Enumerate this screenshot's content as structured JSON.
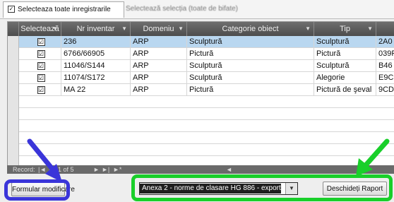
{
  "tabs": [
    {
      "label": "Selecteaza toate inregistrarile",
      "checked": true
    },
    {
      "label": "Selectează selecția (toate de bifate)"
    }
  ],
  "grid": {
    "columns": [
      "Selectează",
      "Nr inventar",
      "Domeniu",
      "Categorie obiect",
      "Tip"
    ],
    "rows": [
      {
        "selected": true,
        "nr": "236",
        "domeniu": "ARP",
        "categorie": "Sculptură",
        "tip": "Sculptură",
        "extra": "2A0"
      },
      {
        "selected": false,
        "nr": "6766/66905",
        "domeniu": "ARP",
        "categorie": "Pictură",
        "tip": "Pictură",
        "extra": "039F"
      },
      {
        "selected": false,
        "nr": "11046/S144",
        "domeniu": "ARP",
        "categorie": "Sculptură",
        "tip": "Sculptură",
        "extra": "B46"
      },
      {
        "selected": false,
        "nr": "11074/S172",
        "domeniu": "ARP",
        "categorie": "Sculptură",
        "tip": "Alegorie",
        "extra": "E9C"
      },
      {
        "selected": false,
        "nr": "MA 22",
        "domeniu": "ARP",
        "categorie": "Pictură",
        "tip": "Pictură de şeval",
        "extra": "9CD"
      }
    ],
    "checkbox_mark": "☑"
  },
  "record_nav": {
    "label": "Record:",
    "position": "1 of 5",
    "first": "|◄",
    "prev": "◄",
    "next": "►",
    "last": "►|",
    "new": "►*"
  },
  "bottom": {
    "formular_button": "Formular modificare",
    "report_select_value": "Anexa 2 - norme de clasare HG 886 - export MS Word",
    "open_report_button": "Deschideți Raport",
    "dropdown_arrow": "▼"
  },
  "annotations": {
    "blue": "#3a35d9",
    "green": "#19cf2a"
  }
}
